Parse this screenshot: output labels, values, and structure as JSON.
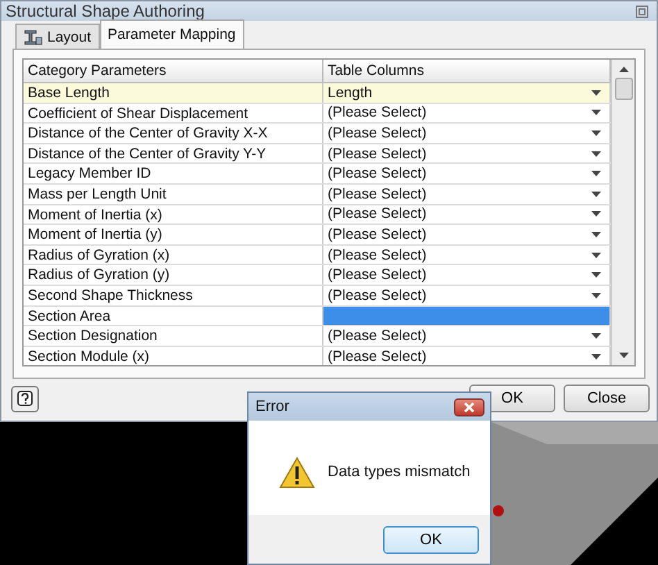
{
  "window": {
    "title": "Structural Shape Authoring"
  },
  "tabs": [
    {
      "label": "Layout",
      "selected": false
    },
    {
      "label": "Parameter Mapping",
      "selected": true
    }
  ],
  "table": {
    "columns": [
      "Category Parameters",
      "Table Columns"
    ],
    "rows": [
      {
        "parameter": "Base Length",
        "value": "Length",
        "selected": true,
        "editing": false
      },
      {
        "parameter": "Coefficient of Shear Displacement",
        "value": "(Please Select)",
        "selected": false,
        "editing": false
      },
      {
        "parameter": "Distance of the Center of Gravity X-X",
        "value": "(Please Select)",
        "selected": false,
        "editing": false
      },
      {
        "parameter": "Distance of the Center of Gravity Y-Y",
        "value": "(Please Select)",
        "selected": false,
        "editing": false
      },
      {
        "parameter": "Legacy Member ID",
        "value": "(Please Select)",
        "selected": false,
        "editing": false
      },
      {
        "parameter": "Mass per Length Unit",
        "value": "(Please Select)",
        "selected": false,
        "editing": false
      },
      {
        "parameter": "Moment of Inertia (x)",
        "value": "(Please Select)",
        "selected": false,
        "editing": false
      },
      {
        "parameter": "Moment of Inertia (y)",
        "value": "(Please Select)",
        "selected": false,
        "editing": false
      },
      {
        "parameter": "Radius of Gyration (x)",
        "value": "(Please Select)",
        "selected": false,
        "editing": false
      },
      {
        "parameter": "Radius of Gyration (y)",
        "value": "(Please Select)",
        "selected": false,
        "editing": false
      },
      {
        "parameter": "Second Shape Thickness",
        "value": "(Please Select)",
        "selected": false,
        "editing": false
      },
      {
        "parameter": "Section Area",
        "selected": false,
        "editing": true
      },
      {
        "parameter": "Section Designation",
        "value": "(Please Select)",
        "selected": false,
        "editing": false
      },
      {
        "parameter": "Section Module (x)",
        "value": "(Please Select)",
        "selected": false,
        "editing": false
      }
    ]
  },
  "buttons": [
    "OK",
    "Close"
  ],
  "error_dialog": {
    "title": "Error",
    "message": "Data types mismatch",
    "buttons": [
      "OK"
    ]
  }
}
